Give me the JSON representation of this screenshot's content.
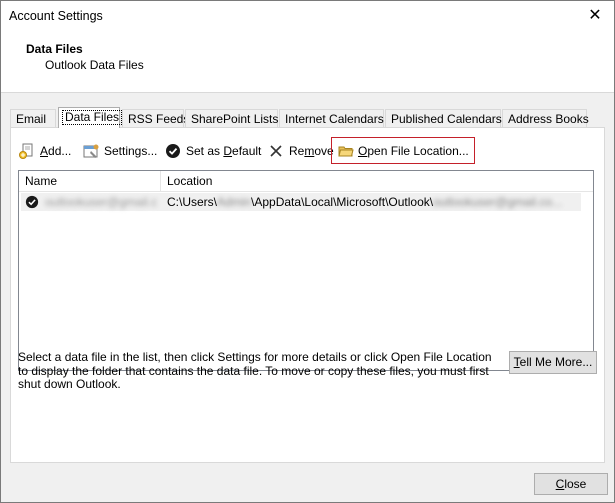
{
  "window": {
    "title": "Account Settings",
    "close_glyph": "✕"
  },
  "header": {
    "title": "Data Files",
    "subtitle": "Outlook Data Files"
  },
  "tabs": [
    {
      "label": "Email",
      "active": false
    },
    {
      "label": "Data Files",
      "active": true
    },
    {
      "label": "RSS Feeds",
      "active": false
    },
    {
      "label": "SharePoint Lists",
      "active": false
    },
    {
      "label": "Internet Calendars",
      "active": false
    },
    {
      "label": "Published Calendars",
      "active": false
    },
    {
      "label": "Address Books",
      "active": false
    }
  ],
  "toolbar": {
    "add_label": "Add...",
    "settings_label": "Settings...",
    "set_default_label": "Set as Default",
    "remove_label": "Remove",
    "open_location_label": "Open File Location..."
  },
  "list": {
    "columns": [
      "Name",
      "Location"
    ],
    "rows": [
      {
        "name": "outlookuser@gmail.com",
        "location_prefix": "C:\\Users\\",
        "location_user": "Admin",
        "location_middle": "\\AppData\\Local\\Microsoft\\Outlook\\",
        "location_file": "outlookuser@gmail.co..."
      }
    ]
  },
  "description": "Select a data file in the list, then click Settings for more details or click Open File Location to display the folder that contains the data file. To move or copy these files, you must first shut down Outlook.",
  "buttons": {
    "tell_me_more": "Tell Me More...",
    "close": "Close"
  },
  "colors": {
    "highlight_border": "#c4202a",
    "dialog_bg": "#f0f0f0"
  }
}
